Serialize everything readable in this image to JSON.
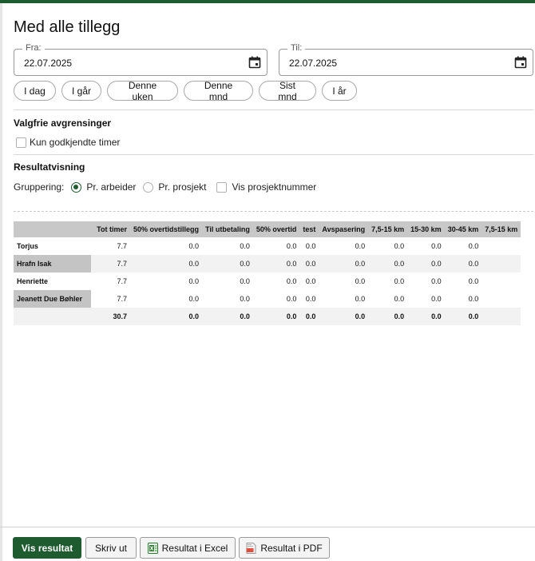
{
  "page": {
    "title": "Med alle tillegg"
  },
  "date_from": {
    "label": "Fra:",
    "value": "22.07.2025"
  },
  "date_to": {
    "label": "Til:",
    "value": "22.07.2025"
  },
  "quick_ranges": [
    "I dag",
    "I går",
    "Denne uken",
    "Denne mnd",
    "Sist mnd",
    "I år"
  ],
  "filters": {
    "title": "Valgfrie avgrensinger",
    "approved_only": {
      "label": "Kun godkjendte timer",
      "checked": false
    }
  },
  "display": {
    "title": "Resultatvisning",
    "grouping_label": "Gruppering:",
    "options": [
      {
        "label": "Pr. arbeider",
        "selected": true
      },
      {
        "label": "Pr. prosjekt",
        "selected": false
      }
    ],
    "show_project_number": {
      "label": "Vis prosjektnummer",
      "checked": false
    }
  },
  "table": {
    "columns": [
      "",
      "Tot timer",
      "50% overtidstillegg",
      "Til utbetaling",
      "50% overtid",
      "test",
      "Avspasering",
      "7,5-15 km",
      "15-30 km",
      "30-45 km",
      "7,5-15 km"
    ],
    "rows": [
      {
        "name": "Torjus",
        "values": [
          "7.7",
          "0.0",
          "0.0",
          "0.0",
          "0.0",
          "0.0",
          "0.0",
          "0.0",
          "0.0",
          ""
        ]
      },
      {
        "name": "Hrafn Isak",
        "values": [
          "7.7",
          "0.0",
          "0.0",
          "0.0",
          "0.0",
          "0.0",
          "0.0",
          "0.0",
          "0.0",
          ""
        ]
      },
      {
        "name": "Henriette",
        "values": [
          "7.7",
          "0.0",
          "0.0",
          "0.0",
          "0.0",
          "0.0",
          "0.0",
          "0.0",
          "0.0",
          ""
        ]
      },
      {
        "name": "Jeanett Due Bøhler",
        "values": [
          "7.7",
          "0.0",
          "0.0",
          "0.0",
          "0.0",
          "0.0",
          "0.0",
          "0.0",
          "0.0",
          ""
        ]
      }
    ],
    "total": {
      "name": "",
      "values": [
        "30.7",
        "0.0",
        "0.0",
        "0.0",
        "0.0",
        "0.0",
        "0.0",
        "0.0",
        "0.0",
        ""
      ]
    }
  },
  "footer": {
    "show_result": "Vis resultat",
    "print": "Skriv ut",
    "excel": "Resultat i Excel",
    "pdf": "Resultat i PDF"
  },
  "colors": {
    "accent": "#1e5c30",
    "header_bg": "#c8c8c8",
    "alt_row": "#f2f2f2"
  }
}
